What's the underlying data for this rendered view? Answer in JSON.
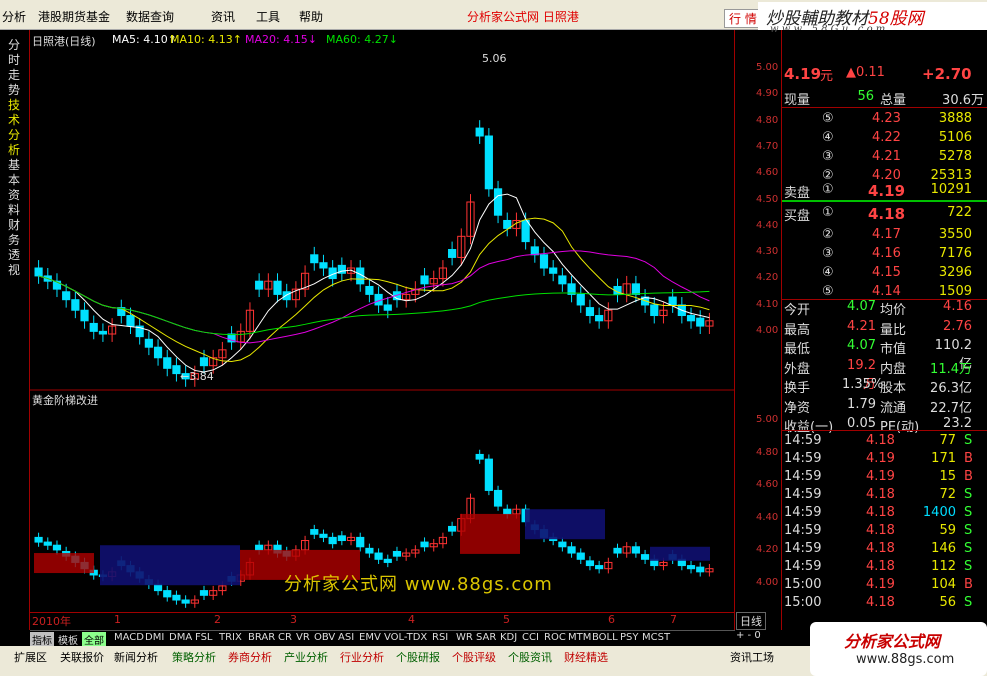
{
  "menu": {
    "items": [
      "分析",
      "港股期货基金",
      "数据查询",
      "资讯",
      "工具",
      "帮助"
    ],
    "title_link": "分析家公式网 日照港",
    "quote_btn": "行 情"
  },
  "brand_top": {
    "line1_a": "炒股輔助教材",
    "line1_b": "58股网",
    "line2": "w w w . 5 8 G u . c o m"
  },
  "sidebar": {
    "tabs": [
      "分时走势",
      "技术分析",
      "基本资料",
      "财务透视"
    ]
  },
  "legend": {
    "name": "日照港(日线)",
    "ma5": "MA5: 4.10↑",
    "ma10": "MA10: 4.13↑",
    "ma20": "MA20: 4.15↓",
    "ma60": "MA60: 4.27↓",
    "high": "5.06",
    "low": "←3.84"
  },
  "indicator": {
    "title": "黄金阶梯改进"
  },
  "axis": {
    "top": [
      "5.00",
      "4.90",
      "4.80",
      "4.70",
      "4.60",
      "4.50",
      "4.40",
      "4.30",
      "4.20",
      "4.10",
      "4.00"
    ],
    "bottom": [
      "5.00",
      "4.80",
      "4.60",
      "4.40",
      "4.20",
      "4.00"
    ]
  },
  "xaxis": {
    "labels": [
      "2010年",
      "1",
      "2",
      "3",
      "4",
      "5",
      "6",
      "7"
    ],
    "mode": "日线"
  },
  "quote": {
    "price": "4.19",
    "unit": "元",
    "change": "▲0.11",
    "pct": "+2.70",
    "vol_label": "现量",
    "vol": "56",
    "total_label": "总量",
    "total": "30.6万",
    "asks": [
      {
        "n": "⑤",
        "p": "4.23",
        "v": "3888"
      },
      {
        "n": "④",
        "p": "4.22",
        "v": "5106"
      },
      {
        "n": "③",
        "p": "4.21",
        "v": "5278"
      },
      {
        "n": "②",
        "p": "4.20",
        "v": "25313"
      }
    ],
    "ask1": {
      "label": "卖盘",
      "n": "①",
      "p": "4.19",
      "v": "10291"
    },
    "bid1": {
      "label": "买盘",
      "n": "①",
      "p": "4.18",
      "v": "722"
    },
    "bids": [
      {
        "n": "②",
        "p": "4.17",
        "v": "3550"
      },
      {
        "n": "③",
        "p": "4.16",
        "v": "7176"
      },
      {
        "n": "④",
        "p": "4.15",
        "v": "3296"
      },
      {
        "n": "⑤",
        "p": "4.14",
        "v": "1509"
      }
    ],
    "stats": [
      {
        "l1": "今开",
        "v1": "4.07",
        "c1": "g",
        "l2": "均价",
        "v2": "4.16",
        "c2": "r"
      },
      {
        "l1": "最高",
        "v1": "4.21",
        "c1": "r",
        "l2": "量比",
        "v2": "2.76",
        "c2": "r"
      },
      {
        "l1": "最低",
        "v1": "4.07",
        "c1": "g",
        "l2": "市值",
        "v2": "110.2亿",
        "c2": "w"
      },
      {
        "l1": "外盘",
        "v1": "19.2万",
        "c1": "r",
        "l2": "内盘",
        "v2": "11.4万",
        "c2": "g"
      },
      {
        "l1": "换手",
        "v1": "1.35%",
        "c1": "w",
        "l2": "股本",
        "v2": "26.3亿",
        "c2": "w"
      },
      {
        "l1": "净资",
        "v1": "1.79",
        "c1": "w",
        "l2": "流通",
        "v2": "22.7亿",
        "c2": "w"
      },
      {
        "l1": "收益(一)",
        "v1": "0.05",
        "c1": "w",
        "l2": "PE(动)",
        "v2": "23.2",
        "c2": "w"
      }
    ],
    "ticks": [
      {
        "t": "14:59",
        "p": "4.18",
        "v": "77",
        "s": "S"
      },
      {
        "t": "14:59",
        "p": "4.19",
        "v": "171",
        "s": "B"
      },
      {
        "t": "14:59",
        "p": "4.19",
        "v": "15",
        "s": "B"
      },
      {
        "t": "14:59",
        "p": "4.18",
        "v": "72",
        "s": "S"
      },
      {
        "t": "14:59",
        "p": "4.18",
        "v": "1400",
        "s": "S"
      },
      {
        "t": "14:59",
        "p": "4.18",
        "v": "59",
        "s": "S"
      },
      {
        "t": "14:59",
        "p": "4.18",
        "v": "146",
        "s": "S"
      },
      {
        "t": "14:59",
        "p": "4.18",
        "v": "112",
        "s": "S"
      },
      {
        "t": "15:00",
        "p": "4.19",
        "v": "104",
        "s": "B"
      },
      {
        "t": "15:00",
        "p": "4.18",
        "v": "56",
        "s": "S"
      }
    ]
  },
  "ind_tabs": [
    "指标",
    "模板",
    "全部",
    "MACD",
    "DMI",
    "DMA",
    "FSL",
    "TRIX",
    "BRAR",
    "CR",
    "VR",
    "OBV",
    "ASI",
    "EMV",
    "VOL-TDX",
    "RSI",
    "WR",
    "SAR",
    "KDJ",
    "CCI",
    "ROC",
    "MTM",
    "BOLL",
    "PSY",
    "MCST"
  ],
  "small_btns": "+ - 0",
  "bottom": [
    "扩展区",
    "关联报价",
    "新闻分析",
    "策略分析",
    "券商分析",
    "产业分析",
    "行业分析",
    "个股研报",
    "个股评级",
    "个股资讯",
    "财经精选",
    "资讯工场"
  ],
  "watermark": "分析家公式网 www.88gs.com",
  "brand_bottom": {
    "b1": "分析家公式网",
    "b2": "www.88gs.com"
  },
  "colors": {
    "up": "#ff3333",
    "down": "#00ffff",
    "ma5": "#ffffff",
    "ma10": "#e8e800",
    "ma20": "#e000e0",
    "ma60": "#00e000",
    "step_up": "#b00000",
    "step_dn": "#101070"
  },
  "chart_data": {
    "type": "candlestick",
    "ylim": [
      3.8,
      5.1
    ],
    "series_note": "daily"
  }
}
